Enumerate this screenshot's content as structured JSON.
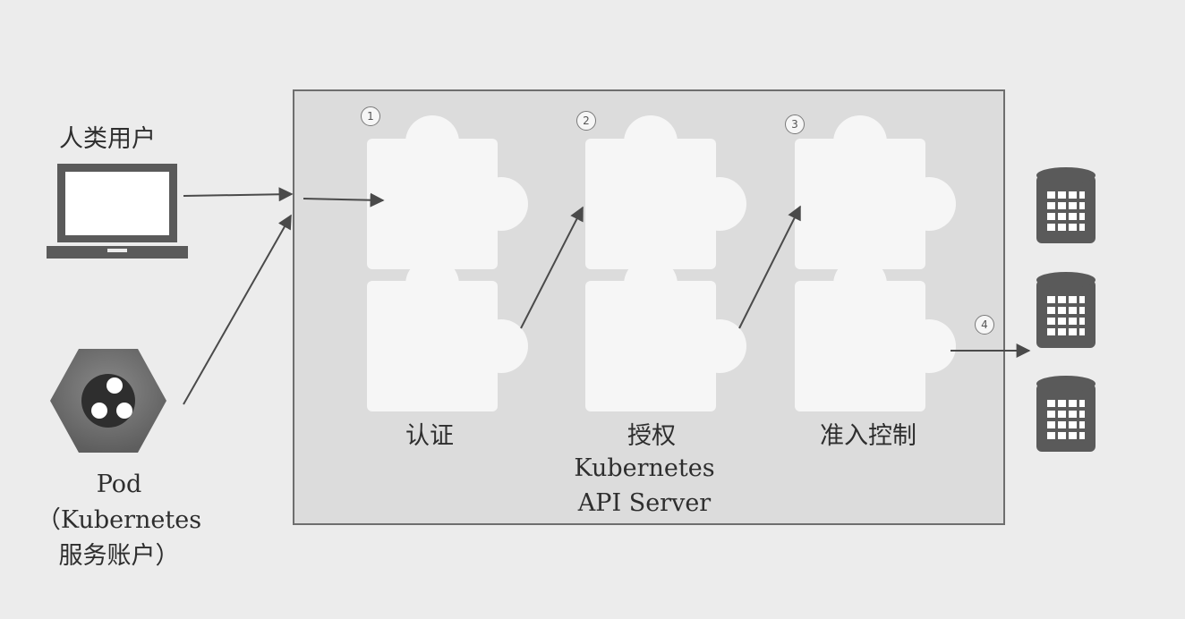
{
  "clients": {
    "human_user_label": "人类用户",
    "pod_label_line1": "Pod",
    "pod_label_line2": "（Kubernetes",
    "pod_label_line3": "服务账户）"
  },
  "server": {
    "title_line1": "Kubernetes",
    "title_line2": "API Server",
    "stages": [
      {
        "number": "1",
        "label": "认证"
      },
      {
        "number": "2",
        "label": "授权"
      },
      {
        "number": "3",
        "label": "准入控制"
      }
    ]
  },
  "storage": {
    "step_number": "4"
  },
  "colors": {
    "background": "#ececec",
    "server_box": "#dcdcdc",
    "puzzle_piece": "#f6f6f6",
    "dark_icon": "#5f5f5f",
    "arrow": "#4a4a4a"
  }
}
